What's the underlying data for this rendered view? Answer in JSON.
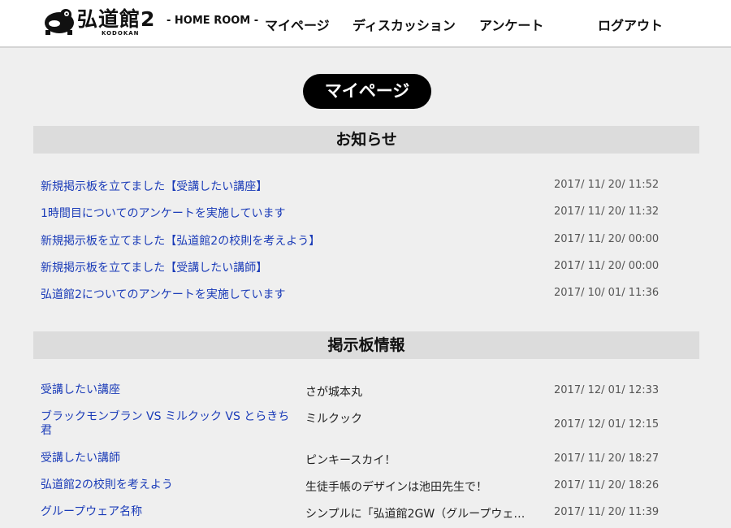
{
  "header": {
    "logo_text": "弘道館2",
    "logo_sub": "KODOKAN",
    "subtitle": "- HOME ROOM -",
    "nav": [
      "マイページ",
      "ディスカッション",
      "アンケート"
    ],
    "logout": "ログアウト"
  },
  "page_title": "マイページ",
  "news": {
    "heading": "お知らせ",
    "items": [
      {
        "title": "新規掲示板を立てました【受講したい講座】",
        "date": "2017/ 11/ 20/ 11:52"
      },
      {
        "title": "1時間目についてのアンケートを実施しています",
        "date": "2017/ 11/ 20/ 11:32"
      },
      {
        "title": "新規掲示板を立てました【弘道館2の校則を考えよう】",
        "date": "2017/ 11/ 20/ 00:00"
      },
      {
        "title": "新規掲示板を立てました【受講したい講師】",
        "date": "2017/ 11/ 20/ 00:00"
      },
      {
        "title": "弘道館2についてのアンケートを実施しています",
        "date": "2017/ 10/ 01/ 11:36"
      }
    ]
  },
  "board": {
    "heading": "掲示板情報",
    "items": [
      {
        "title": "受講したい講座",
        "latest": "さが城本丸",
        "date": "2017/ 12/ 01/ 12:33"
      },
      {
        "title": "ブラックモンブラン VS ミルクック VS とらきち君",
        "latest": "ミルクック",
        "date": "2017/ 12/ 01/ 12:15"
      },
      {
        "title": "受講したい講師",
        "latest": "ピンキースカイ！",
        "date": "2017/ 11/ 20/ 18:27"
      },
      {
        "title": "弘道館2の校則を考えよう",
        "latest": "生徒手帳のデザインは池田先生で！",
        "date": "2017/ 11/ 20/ 18:26"
      },
      {
        "title": "グループウェア名称",
        "latest": "シンプルに「弘道館2GW（グループウェ…",
        "date": "2017/ 11/ 20/ 11:39"
      }
    ]
  }
}
